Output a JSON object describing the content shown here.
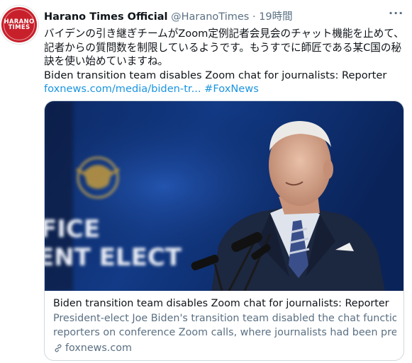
{
  "avatar": {
    "line1": "HARANO",
    "line2": "TIMES"
  },
  "header": {
    "name": "Harano Times Official",
    "handle": "@HaranoTimes",
    "separator": "·",
    "time": "19時間",
    "more": "···"
  },
  "body": {
    "jp_text": "バイデンの引き継ぎチームがZoom定例記者会見会のチャット機能を止めて、記者からの質問数を制限しているようです。もうすでに師匠である某C国の秘訣を使い始めていますね。",
    "en_text": "Biden transition team disables Zoom chat for journalists: Reporter",
    "link": "foxnews.com/media/biden-tr...",
    "hashtag": "#FoxNews"
  },
  "card": {
    "title": "Biden transition team disables Zoom chat for journalists: Reporter",
    "desc_line1": "President-elect Joe Biden's transition team disabled the chat function for",
    "desc_line2": "reporters on conference Zoom calls, where journalists had been pressin...",
    "domain": "foxnews.com",
    "image_text1": "FICE",
    "image_text2": "ENT ELECT"
  },
  "colors": {
    "accent": "#1b95e0",
    "secondary": "#5b7083",
    "brand_red": "#c8202b"
  },
  "icons": {
    "more": "more-icon",
    "link": "link-icon"
  }
}
